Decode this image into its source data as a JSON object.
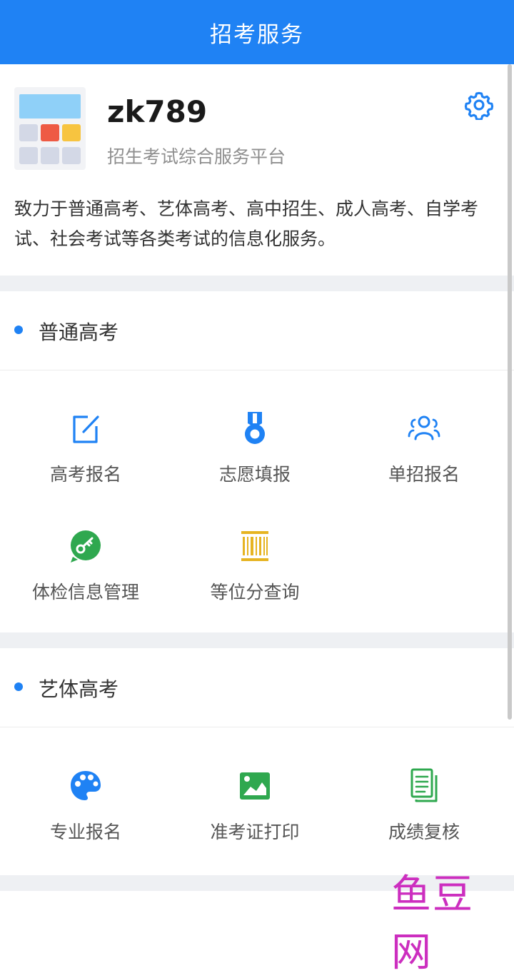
{
  "navbar": {
    "title": "招考服务"
  },
  "profile": {
    "name": "zk789",
    "subtitle": "招生考试综合服务平台",
    "description": "致力于普通高考、艺体高考、高中招生、成人高考、自学考试、社会考试等各类考试的信息化服务。"
  },
  "sections": [
    {
      "title": "普通高考",
      "items": [
        {
          "label": "高考报名",
          "icon": "edit-icon"
        },
        {
          "label": "志愿填报",
          "icon": "medal-icon"
        },
        {
          "label": "单招报名",
          "icon": "group-icon"
        },
        {
          "label": "体检信息管理",
          "icon": "key-icon"
        },
        {
          "label": "等位分查询",
          "icon": "barcode-icon"
        }
      ]
    },
    {
      "title": "艺体高考",
      "items": [
        {
          "label": "专业报名",
          "icon": "palette-icon"
        },
        {
          "label": "准考证打印",
          "icon": "image-icon"
        },
        {
          "label": "成绩复核",
          "icon": "document-icon"
        }
      ]
    }
  ],
  "colors": {
    "primary": "#1f82f4",
    "green": "#2fa84f",
    "yellow": "#e6b422"
  },
  "watermark": "鱼豆网"
}
